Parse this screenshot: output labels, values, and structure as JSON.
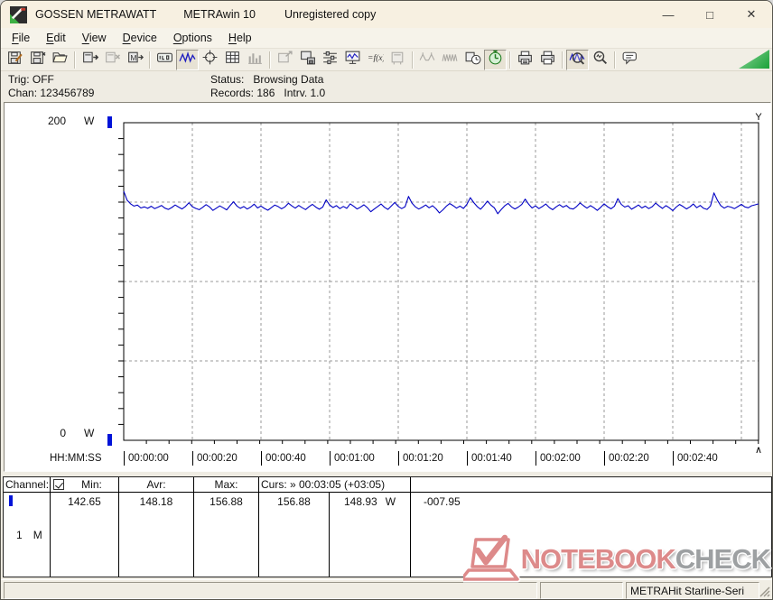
{
  "window": {
    "title_app": "GOSSEN METRAWATT",
    "title_program": "METRAwin 10",
    "title_license": "Unregistered copy",
    "controls": {
      "minimize": "—",
      "maximize": "□",
      "close": "✕"
    }
  },
  "menu": {
    "items": [
      "File",
      "Edit",
      "View",
      "Device",
      "Options",
      "Help"
    ]
  },
  "toolbar": {
    "buttons": [
      {
        "name": "save-button",
        "icon": "disk-pencil"
      },
      {
        "name": "save-as-button",
        "icon": "disk"
      },
      {
        "name": "open-button",
        "icon": "folder-open"
      },
      "sep",
      {
        "name": "read-device-button",
        "icon": "device-out"
      },
      {
        "name": "write-device-button",
        "icon": "device-x",
        "state": "disabled"
      },
      {
        "name": "memory-read-button",
        "icon": "device-m"
      },
      "sep",
      {
        "name": "numeric-view-button",
        "icon": "lcd"
      },
      {
        "name": "chart-view-button",
        "icon": "wave",
        "state": "pressed"
      },
      {
        "name": "cursor-view-button",
        "icon": "crosshair"
      },
      {
        "name": "table-view-button",
        "icon": "grid"
      },
      {
        "name": "histogram-view-button",
        "icon": "bars",
        "state": "disabled"
      },
      "sep",
      {
        "name": "copy-view-button",
        "icon": "device-arrow",
        "state": "disabled"
      },
      {
        "name": "export-button",
        "icon": "device-disk"
      },
      {
        "name": "channel-config-button",
        "icon": "sliders"
      },
      {
        "name": "monitor-button",
        "icon": "monitor"
      },
      {
        "name": "formula-button",
        "icon": "fx"
      },
      {
        "name": "device-settings-button",
        "icon": "device-plug",
        "state": "disabled"
      },
      "sep",
      {
        "name": "sparse-sampling-button",
        "icon": "wave-sparse",
        "state": "disabled"
      },
      {
        "name": "dense-sampling-button",
        "icon": "wave-dense",
        "state": "disabled"
      },
      {
        "name": "record-clock-button",
        "icon": "clock"
      },
      {
        "name": "live-timer-button",
        "icon": "timer-green",
        "state": "pressed"
      },
      "sep",
      {
        "name": "print-report-button",
        "icon": "printer-page"
      },
      {
        "name": "print-button",
        "icon": "printer"
      },
      "sep",
      {
        "name": "zoom-curve-button",
        "icon": "zoom-wave",
        "state": "pressed"
      },
      {
        "name": "zoom-lens-button",
        "icon": "zoom"
      },
      "sep",
      {
        "name": "annotation-button",
        "icon": "speech"
      }
    ]
  },
  "status_panel": {
    "trig": "Trig: OFF",
    "chan": "Chan: 123456789",
    "status": "Status:   Browsing Data",
    "records": "Records: 186   Intrv. 1.0"
  },
  "chart": {
    "y_max_label": "200",
    "y_min_label": "0",
    "y_unit": "W",
    "x_axis_title": "HH:MM:SS",
    "x_labels": [
      "00:00:00",
      "00:00:20",
      "00:00:40",
      "00:01:00",
      "00:01:20",
      "00:01:40",
      "00:02:00",
      "00:02:20",
      "00:02:40"
    ],
    "cursor_top_marker": "Y",
    "cursor_bottom_marker": "∧"
  },
  "chart_data": {
    "type": "line",
    "ylabel": "W",
    "ylim": [
      0,
      200
    ],
    "x_format": "HH:MM:SS",
    "x_tick_interval_s": 20,
    "records": 186,
    "interval_s": 1.0,
    "stats": {
      "min": 142.65,
      "avg": 148.18,
      "max": 156.88
    },
    "cursor": {
      "time": "00:03:05",
      "delta": "+03:05",
      "value_at_start": 156.88,
      "value_at_cursor": 148.93,
      "difference": -7.95
    },
    "grid": {
      "h_lines_at_w": [
        50,
        100,
        150
      ],
      "v_line_every_s": 20
    },
    "series": [
      {
        "name": "Channel 1",
        "unit": "W",
        "color": "#0000c4",
        "values": [
          156.88,
          151.2,
          148.9,
          147.5,
          148.1,
          146.3,
          147.0,
          146.1,
          147.4,
          145.9,
          146.8,
          147.9,
          146.2,
          145.4,
          146.6,
          148.2,
          146.9,
          145.7,
          147.3,
          149.6,
          147.1,
          146.0,
          145.2,
          146.7,
          148.4,
          147.0,
          144.8,
          146.2,
          147.6,
          146.4,
          145.1,
          147.8,
          150.2,
          147.5,
          146.1,
          147.2,
          145.6,
          146.9,
          148.7,
          146.3,
          147.5,
          146.0,
          144.9,
          146.5,
          148.1,
          147.2,
          145.8,
          147.0,
          149.3,
          147.6,
          146.2,
          147.9,
          146.5,
          145.3,
          147.1,
          148.6,
          146.8,
          145.5,
          146.9,
          151.4,
          148.2,
          146.6,
          147.8,
          145.9,
          147.3,
          146.1,
          148.9,
          147.4,
          145.7,
          146.8,
          148.3,
          146.5,
          143.9,
          145.6,
          147.2,
          148.8,
          146.7,
          145.4,
          147.6,
          149.8,
          147.3,
          145.9,
          147.1,
          153.6,
          149.4,
          147.0,
          145.6,
          146.8,
          148.2,
          146.4,
          147.7,
          145.8,
          143.2,
          145.1,
          147.4,
          149.1,
          147.8,
          146.2,
          147.5,
          146.0,
          148.6,
          152.8,
          149.7,
          147.2,
          145.5,
          147.9,
          150.6,
          148.1,
          146.4,
          142.65,
          145.3,
          147.6,
          149.2,
          147.0,
          145.7,
          146.9,
          148.5,
          151.9,
          148.7,
          146.3,
          147.6,
          145.9,
          147.2,
          148.8,
          146.6,
          145.2,
          147.0,
          148.4,
          146.8,
          147.9,
          146.1,
          145.6,
          147.3,
          149.5,
          147.7,
          146.2,
          147.8,
          146.5,
          144.8,
          146.7,
          148.9,
          147.1,
          145.8,
          147.4,
          152.2,
          148.6,
          146.9,
          147.7,
          145.5,
          146.8,
          148.2,
          146.3,
          147.5,
          145.9,
          147.1,
          149.4,
          147.6,
          146.0,
          147.8,
          146.4,
          144.6,
          146.9,
          148.5,
          147.2,
          145.7,
          147.0,
          148.8,
          146.5,
          147.9,
          146.1,
          145.4,
          147.6,
          155.8,
          151.2,
          147.8,
          146.2,
          147.4,
          146.8,
          145.9,
          147.2,
          148.6,
          147.0,
          146.4,
          147.7,
          148.3,
          148.93
        ]
      }
    ]
  },
  "table": {
    "headers": {
      "channel": "Channel:",
      "min": "Min:",
      "avr": "Avr:",
      "max": "Max:",
      "curs": "Curs: » 00:03:05 (+03:05)"
    },
    "checkbox_checked": true,
    "row": {
      "channel_no": "1",
      "channel_mode": "M",
      "min": "142.65",
      "avr": "148.18",
      "max": "156.88",
      "curs_value_1": "156.88",
      "curs_value_2": "148.93",
      "curs_unit": "W",
      "difference": "-007.95"
    }
  },
  "statusbar": {
    "device": "METRAHit Starline-Seri"
  },
  "watermark": {
    "text_primary": "NOTEBOOK",
    "text_secondary": "CHECK",
    "color_primary": "#dd8a8a",
    "color_secondary": "#9da0a2"
  },
  "colors": {
    "wave": "#0000c4",
    "marker_blue": "#0013d8",
    "grid_gray": "#9a9a9a",
    "titlebar": "#f7f0e1",
    "toolbar_triangle": "#19a238"
  }
}
